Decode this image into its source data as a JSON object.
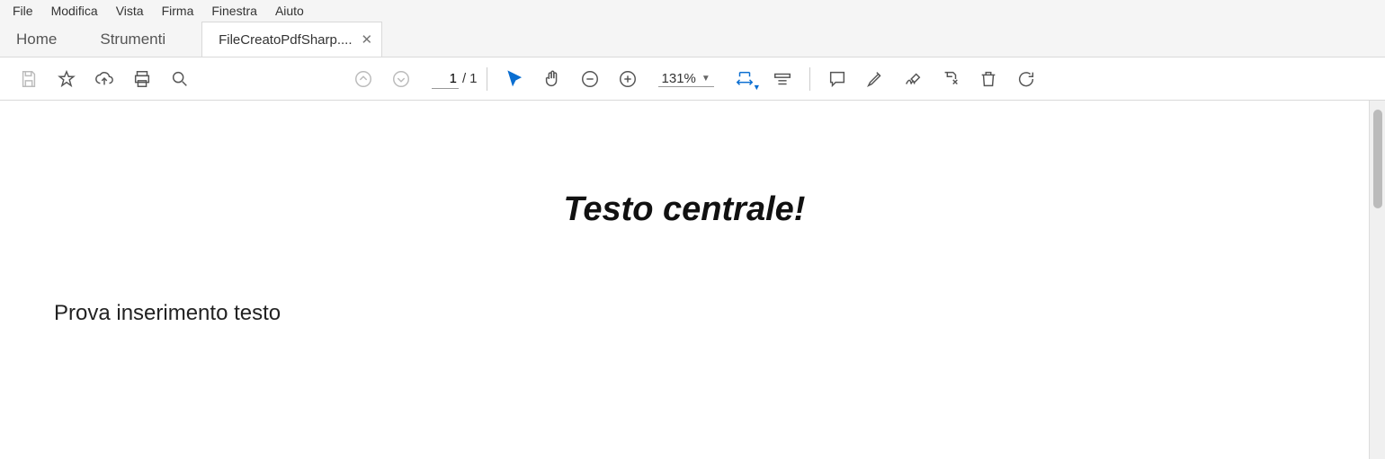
{
  "menu": {
    "items": [
      "File",
      "Modifica",
      "Vista",
      "Firma",
      "Finestra",
      "Aiuto"
    ]
  },
  "tabs": {
    "home": "Home",
    "tools": "Strumenti",
    "document": "FileCreatoPdfSharp...."
  },
  "toolbar": {
    "page_current": "1",
    "page_sep": "/",
    "page_total": "1",
    "zoom": "131%"
  },
  "document": {
    "heading": "Testo centrale!",
    "body": "Prova inserimento testo"
  }
}
